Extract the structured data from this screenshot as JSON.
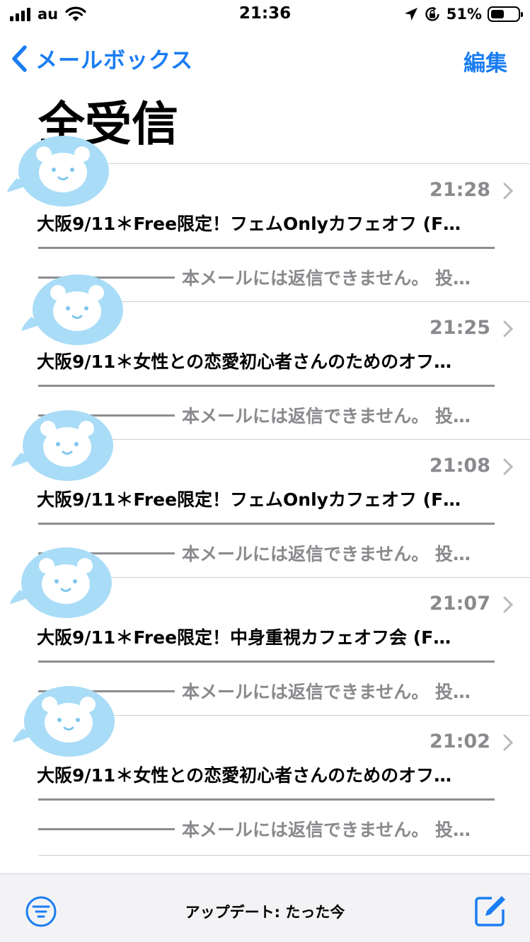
{
  "status_bar": {
    "carrier": "au",
    "time": "21:36",
    "battery_pct": "51%",
    "battery_level": 0.51,
    "icons": [
      "signal-icon",
      "wifi-icon",
      "location-arrow-icon",
      "rotation-lock-icon",
      "battery-icon"
    ]
  },
  "nav": {
    "back_label": "メールボックス",
    "edit_label": "編集"
  },
  "title": "全受信",
  "messages": [
    {
      "time": "21:28",
      "subject": "大阪9/11＊Free限定！フェムOnlyカフェオフ (F…",
      "preview": "本メールには返信できません。 投…"
    },
    {
      "time": "21:25",
      "subject": "大阪9/11＊女性との恋愛初心者さんのためのオフ…",
      "preview": "本メールには返信できません。 投…"
    },
    {
      "time": "21:08",
      "subject": "大阪9/11＊Free限定！フェムOnlyカフェオフ (F…",
      "preview": "本メールには返信できません。 投…"
    },
    {
      "time": "21:07",
      "subject": "大阪9/11＊Free限定！中身重視カフェオフ会 (F…",
      "preview": "本メールには返信できません。 投…"
    },
    {
      "time": "21:02",
      "subject": "大阪9/11＊女性との恋愛初心者さんのためのオフ…",
      "preview": "本メールには返信できません。 投…"
    }
  ],
  "toolbar": {
    "status": "アップデート: たった今"
  },
  "colors": {
    "accent": "#1a7df2",
    "secondary_text": "#8a8a8e",
    "sticker": "#a9dcf7"
  }
}
